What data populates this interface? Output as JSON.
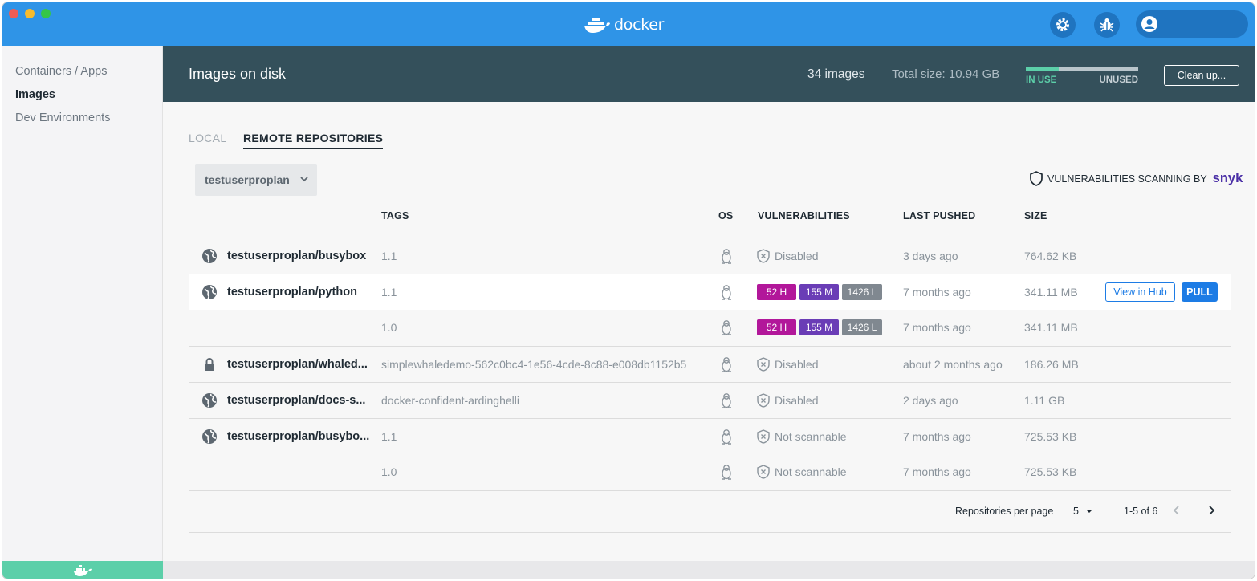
{
  "titlebar": {
    "brand": "docker",
    "icons": [
      "settings-gear-icon",
      "bug-icon",
      "account-icon"
    ]
  },
  "sidebar": {
    "items": [
      {
        "label": "Containers / Apps",
        "active": false
      },
      {
        "label": "Images",
        "active": true
      },
      {
        "label": "Dev Environments",
        "active": false
      }
    ]
  },
  "banner": {
    "title": "Images on disk",
    "count": "34 images",
    "total_size": "Total size: 10.94 GB",
    "in_use_label": "IN USE",
    "unused_label": "UNUSED",
    "in_use_fraction": 0.29,
    "cleanup_label": "Clean up..."
  },
  "tabs": [
    {
      "label": "LOCAL",
      "active": false
    },
    {
      "label": "REMOTE REPOSITORIES",
      "active": true
    }
  ],
  "repo_select": {
    "value": "testuserproplan"
  },
  "scanning": {
    "label": "VULNERABILITIES SCANNING BY",
    "brand": "snyk"
  },
  "table": {
    "headers": {
      "tags": "TAGS",
      "os": "OS",
      "vulnerabilities": "VULNERABILITIES",
      "last_pushed": "LAST PUSHED",
      "size": "SIZE"
    },
    "rows": [
      {
        "repo": "testuserproplan/busybox",
        "tag": "1.1",
        "vuln": "Disabled",
        "pushed": "3 days ago",
        "size": "764.62 KB"
      },
      {
        "repo": "testuserproplan/python",
        "tag": "1.1",
        "high": "52 H",
        "medium": "155 M",
        "low": "1426 L",
        "pushed": "7 months ago",
        "size": "341.11 MB",
        "view_hub": "View in Hub",
        "pull": "PULL"
      },
      {
        "repo": "",
        "tag": "1.0",
        "high": "52 H",
        "medium": "155 M",
        "low": "1426 L",
        "pushed": "7 months ago",
        "size": "341.11 MB"
      },
      {
        "repo": "testuserproplan/whaled...",
        "tag": "simplewhaledemo-562c0bc4-1e56-4cde-8c88-e008db1152b5",
        "vuln": "Disabled",
        "pushed": "about 2 months ago",
        "size": "186.26 MB"
      },
      {
        "repo": "testuserproplan/docs-s...",
        "tag": "docker-confident-ardinghelli",
        "vuln": "Disabled",
        "pushed": "2 days ago",
        "size": "1.11 GB"
      },
      {
        "repo": "testuserproplan/busybo...",
        "tag": "1.1",
        "vuln": "Not scannable",
        "pushed": "7 months ago",
        "size": "725.53 KB"
      },
      {
        "repo": "",
        "tag": "1.0",
        "vuln": "Not scannable",
        "pushed": "7 months ago",
        "size": "725.53 KB"
      }
    ]
  },
  "pagination": {
    "per_page_label": "Repositories per page",
    "per_page_value": "5",
    "range": "1-5 of 6"
  }
}
